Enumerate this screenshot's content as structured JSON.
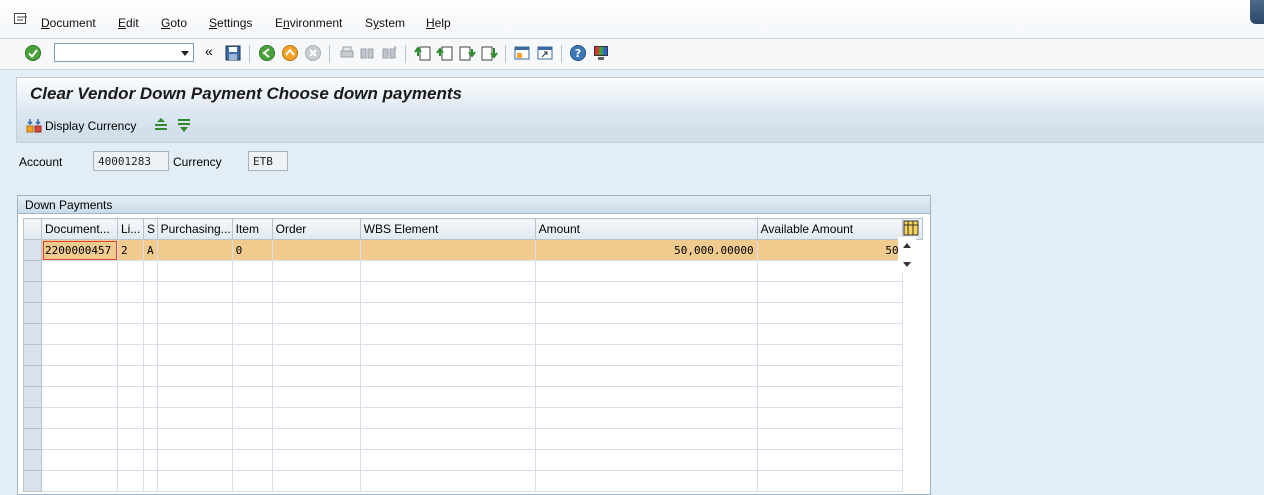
{
  "menu": {
    "items": [
      {
        "label": "Document",
        "accel": "D",
        "rest": "ocument"
      },
      {
        "label": "Edit",
        "accel": "E",
        "rest": "dit"
      },
      {
        "label": "Goto",
        "accel": "G",
        "rest": "oto"
      },
      {
        "label": "Settings",
        "accel": "S",
        "rest": "ettings"
      },
      {
        "label": "Environment",
        "accel": "n",
        "pre": "E",
        "rest": "vironment"
      },
      {
        "label": "System",
        "accel": "y",
        "pre": "S",
        "rest": "stem"
      },
      {
        "label": "Help",
        "accel": "H",
        "rest": "elp"
      }
    ]
  },
  "toolbar": {
    "command_field_value": "",
    "icons": [
      "enter-icon",
      "save-icon",
      "back-icon",
      "exit-icon",
      "cancel-icon",
      "print-icon",
      "find-icon",
      "find-next-icon",
      "first-page-icon",
      "previous-page-icon",
      "next-page-icon",
      "last-page-icon",
      "create-session-icon",
      "shortcut-icon",
      "help-icon",
      "customize-layout-icon"
    ],
    "collapse_glyph": "«"
  },
  "title": "Clear Vendor Down Payment Choose down payments",
  "app_toolbar": {
    "display_currency_label": "Display Currency"
  },
  "header_fields": {
    "account_label": "Account",
    "account_value": "40001283",
    "currency_label": "Currency",
    "currency_value": "ETB"
  },
  "down_payments": {
    "group_title": "Down Payments",
    "columns": [
      "Document...",
      "Li...",
      "S",
      "Purchasing...",
      "Item",
      "Order",
      "WBS Element",
      "Amount",
      "Available Amount"
    ],
    "rows": [
      {
        "document": "2200000457",
        "line": "2",
        "s": "A",
        "purchasing": "",
        "item": "0",
        "order": "",
        "wbs": "",
        "amount": "50,000.00000",
        "available": "50"
      }
    ]
  },
  "colors": {
    "highlight_row": "#f0cb8d",
    "background": "#e3edf5",
    "title_text": "#1b1b1b"
  }
}
